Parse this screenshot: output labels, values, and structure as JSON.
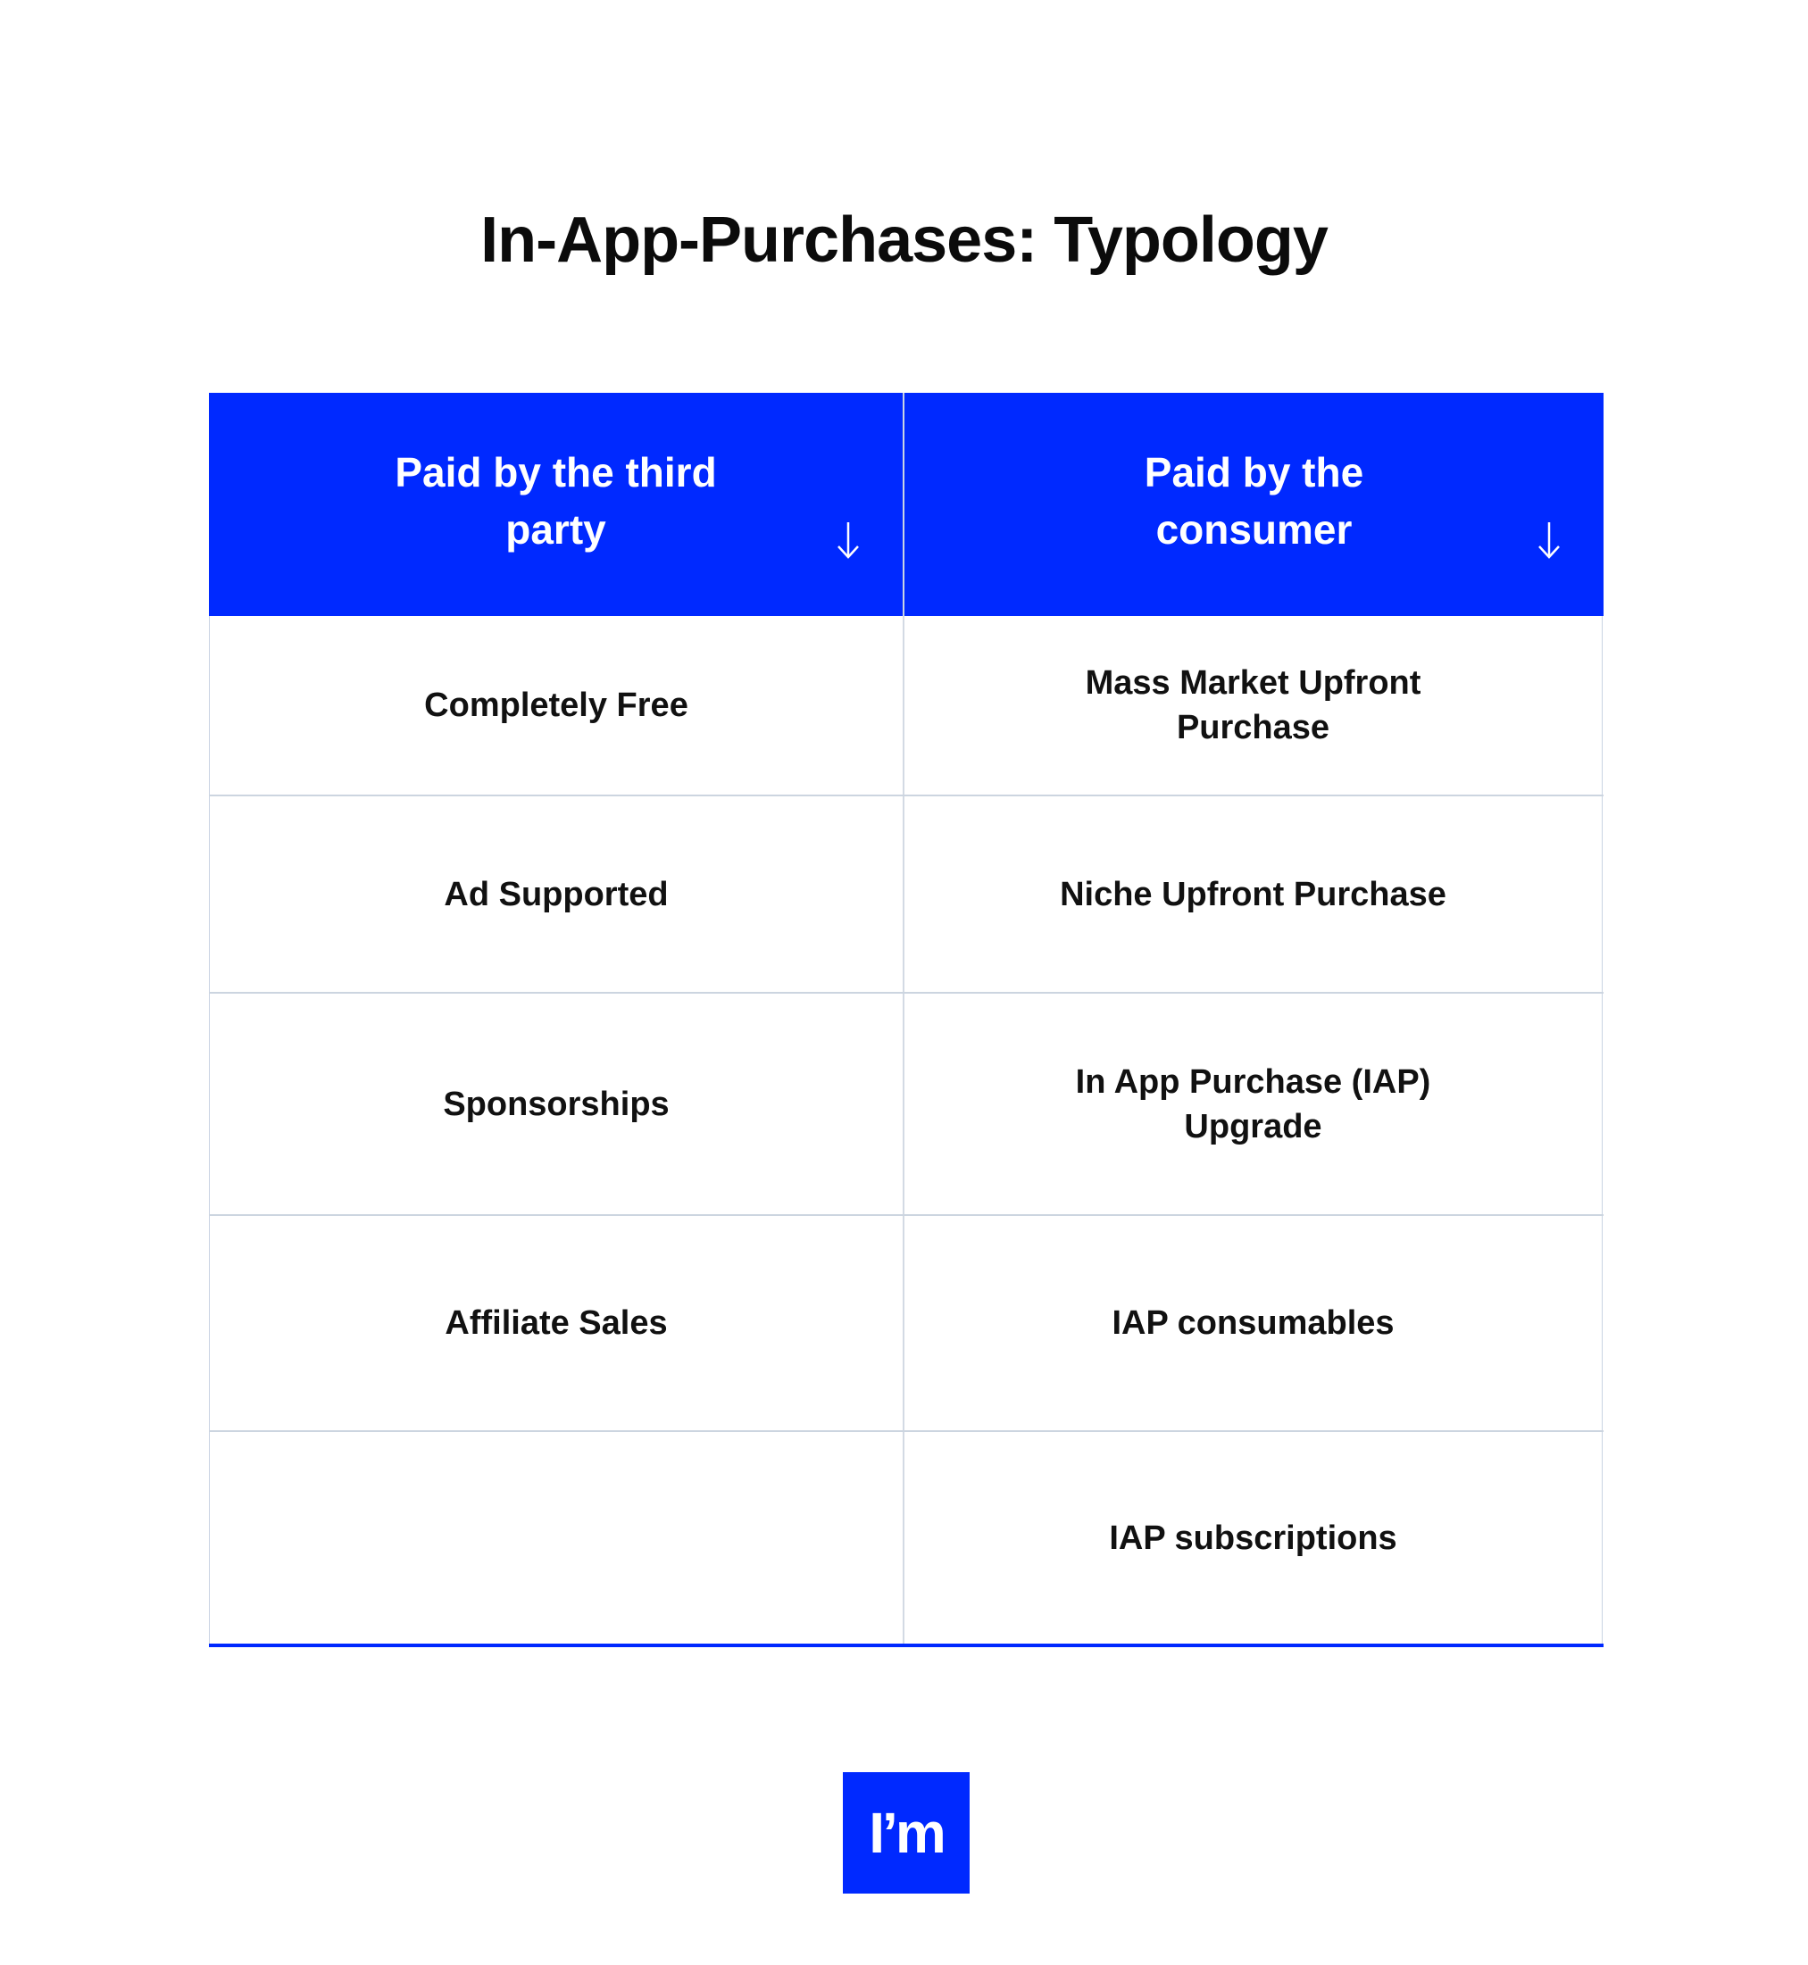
{
  "title": "In-App-Purchases: Typology",
  "table": {
    "headers": [
      {
        "label": "Paid by the third\nparty",
        "icon": "arrow-down-icon"
      },
      {
        "label": "Paid by the\nconsumer",
        "icon": "arrow-down-icon"
      }
    ],
    "rows": [
      [
        "Completely Free",
        "Mass Market Upfront\nPurchase"
      ],
      [
        "Ad Supported",
        "Niche Upfront Purchase"
      ],
      [
        "Sponsorships",
        "In App Purchase (IAP)\nUpgrade"
      ],
      [
        "Affiliate Sales",
        "IAP consumables"
      ],
      [
        "",
        "IAP subscriptions"
      ]
    ]
  },
  "logo": {
    "text": "I’m"
  },
  "colors": {
    "accent": "#0029ff",
    "grid": "#ccd5e0",
    "text": "#111111"
  }
}
